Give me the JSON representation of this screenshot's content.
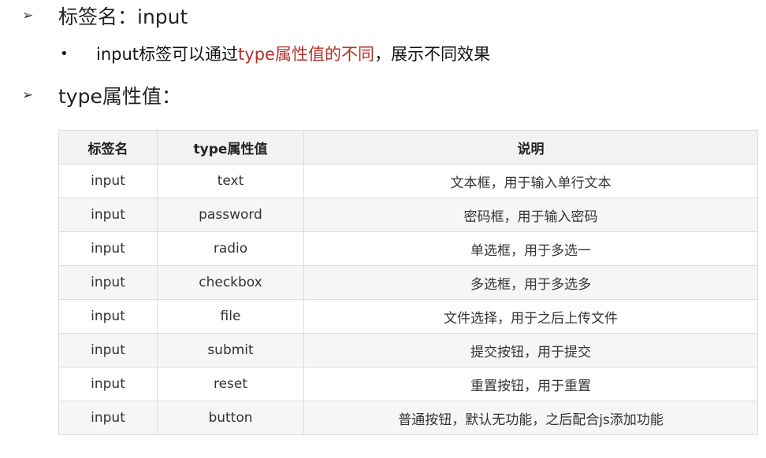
{
  "heading1": {
    "bullet": "➢",
    "text": "标签名：input"
  },
  "subpoint": {
    "bullet": "•",
    "text_before": "input标签可以通过",
    "text_highlight": "type属性值的不同",
    "text_after": "，展示不同效果",
    "highlight_color": "#b4312a"
  },
  "heading2": {
    "bullet": "➢",
    "text": "type属性值："
  },
  "table": {
    "headers": [
      "标签名",
      "type属性值",
      "说明"
    ],
    "rows": [
      [
        "input",
        "text",
        "文本框，用于输入单行文本"
      ],
      [
        "input",
        "password",
        "密码框，用于输入密码"
      ],
      [
        "input",
        "radio",
        "单选框，用于多选一"
      ],
      [
        "input",
        "checkbox",
        "多选框，用于多选多"
      ],
      [
        "input",
        "file",
        "文件选择，用于之后上传文件"
      ],
      [
        "input",
        "submit",
        "提交按钮，用于提交"
      ],
      [
        "input",
        "reset",
        "重置按钮，用于重置"
      ],
      [
        "input",
        "button",
        "普通按钮，默认无功能，之后配合js添加功能"
      ]
    ]
  }
}
